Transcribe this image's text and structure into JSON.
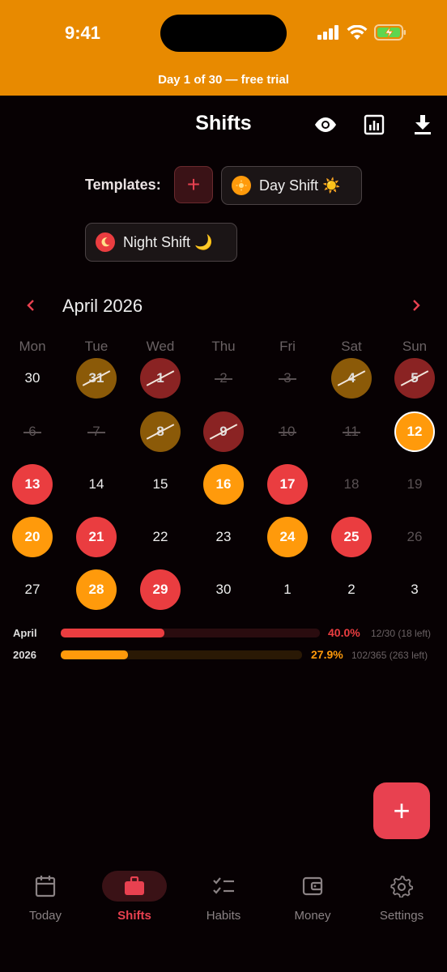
{
  "status_bar": {
    "time": "9:41",
    "trial_banner": "Day 1 of 30 — free trial"
  },
  "header": {
    "title": "Shifts",
    "icons": [
      "eye-icon",
      "chart-icon",
      "download-icon"
    ]
  },
  "templates": {
    "label": "Templates:",
    "add_label": "+",
    "items": [
      {
        "label": "Day Shift ☀️",
        "icon": "sun-icon",
        "color": "#FF9A0B"
      },
      {
        "label": "Night Shift 🌙",
        "icon": "moon-icon",
        "color": "#EA3D40"
      }
    ]
  },
  "calendar": {
    "month_label": "April 2026",
    "prev": "‹",
    "next": "›",
    "weekdays": [
      "Mon",
      "Tue",
      "Wed",
      "Thu",
      "Fri",
      "Sat",
      "Sun"
    ],
    "weeks": [
      [
        {
          "d": "30",
          "s": "plain"
        },
        {
          "d": "31",
          "s": "pastorange",
          "x": true
        },
        {
          "d": "1",
          "s": "pastred",
          "x": true
        },
        {
          "d": "2",
          "s": "struck-plain",
          "x": true
        },
        {
          "d": "3",
          "s": "struck-plain",
          "x": true
        },
        {
          "d": "4",
          "s": "pastorange",
          "x": true
        },
        {
          "d": "5",
          "s": "pastred",
          "x": true
        }
      ],
      [
        {
          "d": "6",
          "s": "struck-plain",
          "x": true
        },
        {
          "d": "7",
          "s": "struck-plain",
          "x": true
        },
        {
          "d": "8",
          "s": "pastorange",
          "x": true
        },
        {
          "d": "9",
          "s": "pastred",
          "x": true
        },
        {
          "d": "10",
          "s": "struck-plain",
          "x": true
        },
        {
          "d": "11",
          "s": "struck-plain",
          "x": true
        },
        {
          "d": "12",
          "s": "orange",
          "today": true
        }
      ],
      [
        {
          "d": "13",
          "s": "red"
        },
        {
          "d": "14",
          "s": "plain"
        },
        {
          "d": "15",
          "s": "plain"
        },
        {
          "d": "16",
          "s": "orange"
        },
        {
          "d": "17",
          "s": "red"
        },
        {
          "d": "18",
          "s": "dim"
        },
        {
          "d": "19",
          "s": "dim"
        }
      ],
      [
        {
          "d": "20",
          "s": "orange"
        },
        {
          "d": "21",
          "s": "red"
        },
        {
          "d": "22",
          "s": "plain"
        },
        {
          "d": "23",
          "s": "plain"
        },
        {
          "d": "24",
          "s": "orange"
        },
        {
          "d": "25",
          "s": "red"
        },
        {
          "d": "26",
          "s": "dim"
        }
      ],
      [
        {
          "d": "27",
          "s": "plain"
        },
        {
          "d": "28",
          "s": "orange"
        },
        {
          "d": "29",
          "s": "red"
        },
        {
          "d": "30",
          "s": "plain"
        },
        {
          "d": "1",
          "s": "plain"
        },
        {
          "d": "2",
          "s": "plain"
        },
        {
          "d": "3",
          "s": "plain"
        }
      ]
    ]
  },
  "progress": [
    {
      "label": "April",
      "percent": 40.0,
      "percent_text": "40.0%",
      "count": "12/30 (18 left)",
      "color": "#EA3D40",
      "track": "#2a0c0f"
    },
    {
      "label": "2026",
      "percent": 27.9,
      "percent_text": "27.9%",
      "count": "102/365 (263 left)",
      "color": "#FF9A0B",
      "track": "#2a1905"
    }
  ],
  "fab": {
    "label": "+"
  },
  "tabs": [
    {
      "label": "Today",
      "icon": "calendar-icon",
      "active": false
    },
    {
      "label": "Shifts",
      "icon": "briefcase-icon",
      "active": true
    },
    {
      "label": "Habits",
      "icon": "checklist-icon",
      "active": false
    },
    {
      "label": "Money",
      "icon": "wallet-icon",
      "active": false
    },
    {
      "label": "Settings",
      "icon": "gear-icon",
      "active": false
    }
  ]
}
